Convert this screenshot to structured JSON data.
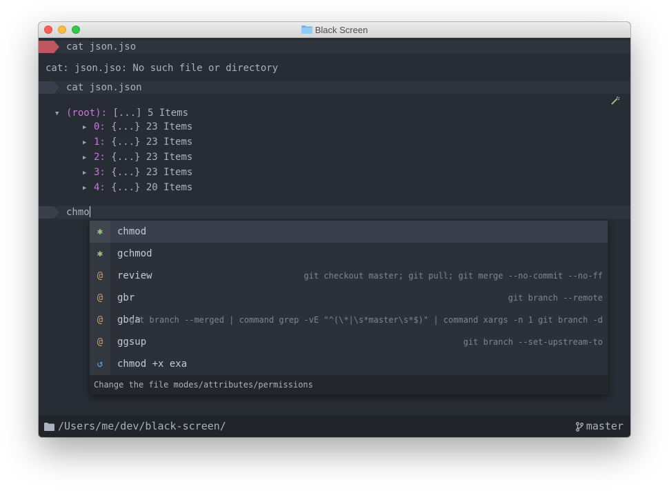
{
  "window": {
    "title": "Black Screen",
    "folder_icon": "folder-icon"
  },
  "colors": {
    "prompt_error": "#e06c75",
    "prompt_ok": "#3a3f4b",
    "accent_key": "#c678dd",
    "git_icon": "#98c379",
    "alias_icon": "#d19a66",
    "history_icon": "#61afef"
  },
  "session": {
    "prompt1": {
      "command": "cat json.jso",
      "status": "error"
    },
    "error_output": "cat: json.jso: No such file or directory",
    "prompt2": {
      "command": "cat json.json",
      "status": "ok"
    },
    "tree": {
      "root_label": "(root):",
      "root_summary": "[...] 5 Items",
      "items": [
        {
          "key": "0:",
          "summary": "{...} 23 Items"
        },
        {
          "key": "1:",
          "summary": "{...} 23 Items"
        },
        {
          "key": "2:",
          "summary": "{...} 23 Items"
        },
        {
          "key": "3:",
          "summary": "{...} 23 Items"
        },
        {
          "key": "4:",
          "summary": "{...} 20 Items"
        }
      ]
    },
    "current_input": "chmo"
  },
  "autocomplete": {
    "items": [
      {
        "icon": "✱",
        "icon_name": "executable-icon",
        "label": "chmod",
        "desc": ""
      },
      {
        "icon": "✱",
        "icon_name": "executable-icon",
        "label": "gchmod",
        "desc": ""
      },
      {
        "icon": "@",
        "icon_name": "alias-icon",
        "label": "review",
        "desc": "git checkout master; git pull; git merge --no-commit --no-ff"
      },
      {
        "icon": "@",
        "icon_name": "alias-icon",
        "label": "gbr",
        "desc": "git branch --remote"
      },
      {
        "icon": "@",
        "icon_name": "alias-icon",
        "label": "gbda",
        "desc": "git branch --merged | command grep -vE \"^(\\*|\\s*master\\s*$)\" | command xargs -n 1 git branch -d"
      },
      {
        "icon": "@",
        "icon_name": "alias-icon",
        "label": "ggsup",
        "desc": "git branch --set-upstream-to"
      },
      {
        "icon": "↺",
        "icon_name": "history-icon",
        "label": "chmod +x exa",
        "desc": ""
      }
    ],
    "description": "Change the file modes/attributes/permissions"
  },
  "status": {
    "path": "/Users/me/dev/black-screen/",
    "branch": "master"
  }
}
